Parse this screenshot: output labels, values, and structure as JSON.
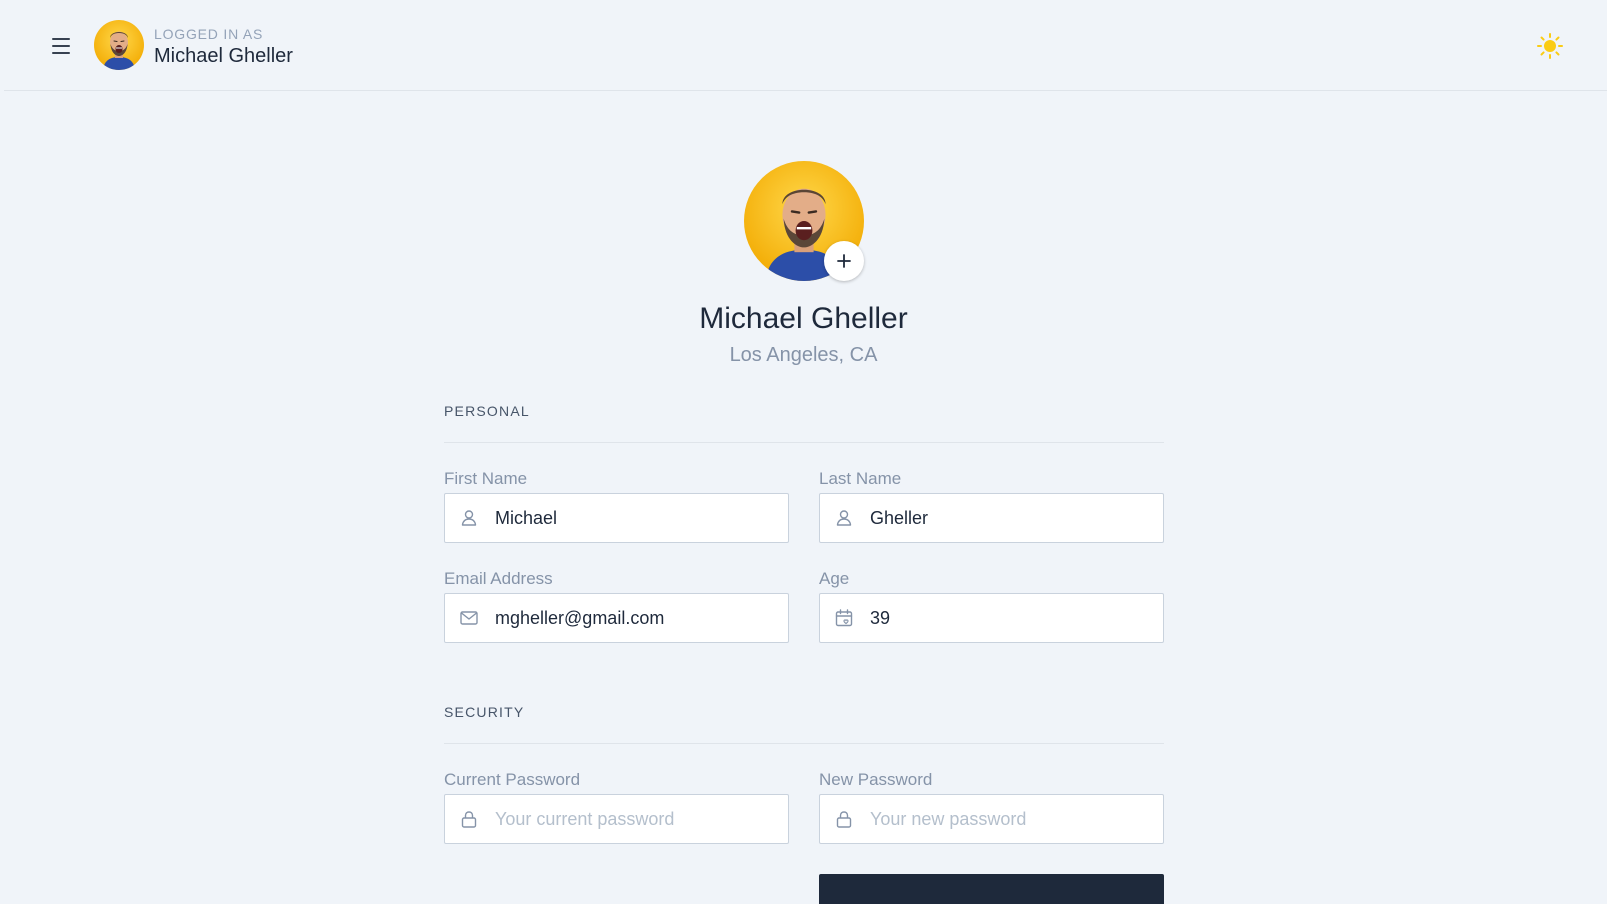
{
  "header": {
    "logged_in_label": "LOGGED IN AS",
    "user_name": "Michael Gheller"
  },
  "profile": {
    "name": "Michael Gheller",
    "location": "Los Angeles, CA"
  },
  "personal": {
    "section_title": "PERSONAL",
    "first_name": {
      "label": "First Name",
      "value": "Michael",
      "icon": "user-icon"
    },
    "last_name": {
      "label": "Last Name",
      "value": "Gheller",
      "icon": "user-icon"
    },
    "email": {
      "label": "Email Address",
      "value": "mgheller@gmail.com",
      "icon": "mail-icon"
    },
    "age": {
      "label": "Age",
      "value": "39",
      "icon": "calendar-icon"
    }
  },
  "security": {
    "section_title": "SECURITY",
    "current_password": {
      "label": "Current Password",
      "placeholder": "Your current password",
      "icon": "lock-icon"
    },
    "new_password": {
      "label": "New Password",
      "placeholder": "Your new password",
      "icon": "lock-icon"
    }
  },
  "colors": {
    "background": "#f0f4f9",
    "accent_sun": "#facc15",
    "avatar_bg": "#f5b800",
    "dark_button": "#1e293b"
  }
}
